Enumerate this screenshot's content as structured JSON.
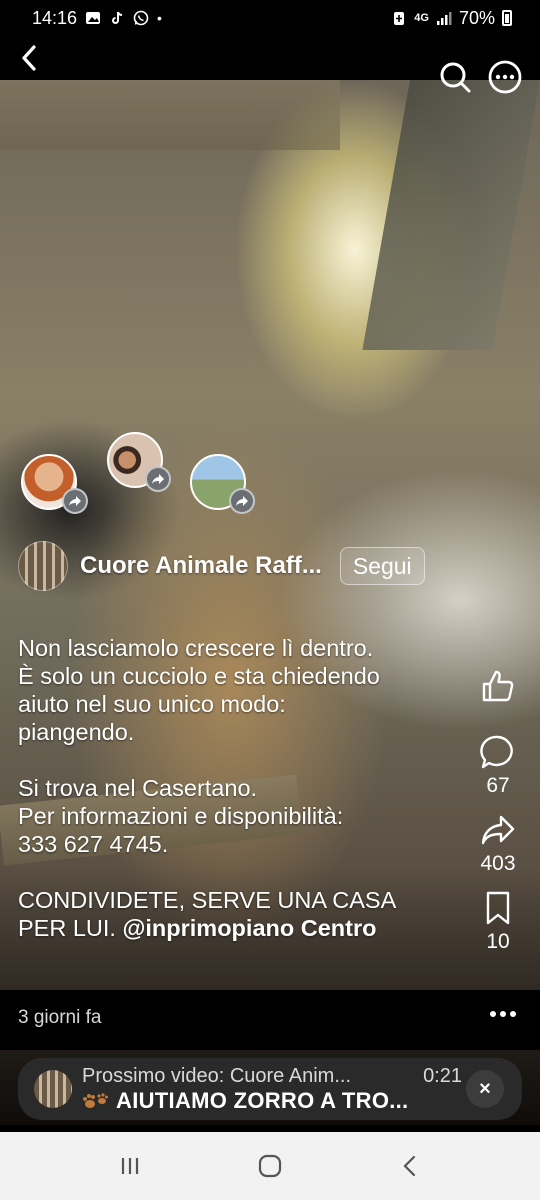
{
  "status_bar": {
    "time": "14:16",
    "network": "4G",
    "battery": "70%"
  },
  "post": {
    "author_name": "Cuore Animale Raff...",
    "follow_label": "Segui",
    "caption_lines": [
      "Non lasciamolo crescere lì dentro.",
      "È solo un cucciolo e sta chiedendo",
      "aiuto nel suo unico modo:",
      "piangendo.",
      "",
      "Si trova nel Casertano.",
      "Per informazioni e disponibilità:",
      "333 627 4745.",
      "",
      "CONDIVIDETE, SERVE UNA CASA",
      "PER LUI."
    ],
    "caption_mention": "@inprimopiano Centro",
    "time_ago": "3 giorni fa"
  },
  "actions": {
    "like_icon": "thumbs-up-icon",
    "comments_count": "67",
    "shares_count": "403",
    "saves_count": "10"
  },
  "next_video": {
    "label": "Prossimo video: Cuore Anim...",
    "duration": "0:21",
    "title": "AIUTIAMO ZORRO A TRO...",
    "close_label": "×"
  }
}
